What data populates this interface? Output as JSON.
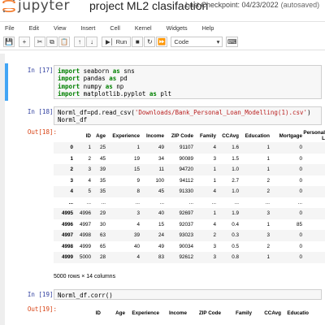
{
  "header": {
    "logo_text": "jupyter",
    "notebook_title": "project ML2 clasifaction",
    "checkpoint": "Last Checkpoint: 04/23/2022",
    "autosaved": "(autosaved)"
  },
  "menu": [
    "File",
    "Edit",
    "View",
    "Insert",
    "Cell",
    "Kernel",
    "Widgets",
    "Help"
  ],
  "toolbar": {
    "run_label": "Run",
    "cell_type": "Code"
  },
  "cells": {
    "c17": {
      "prompt": "In [17]:",
      "lines": [
        [
          "import",
          " seaborn ",
          "as",
          " sns"
        ],
        [
          "import",
          " pandas ",
          "as",
          " pd"
        ],
        [
          "import",
          " numpy ",
          "as",
          " np"
        ],
        [
          "import",
          " matplotlib.pyplot ",
          "as",
          " plt"
        ]
      ]
    },
    "c18": {
      "prompt": "In [18]:",
      "line1_pre": "Norml_df=pd.read_csv(",
      "line1_str": "'Downloads/Bank_Personal_Loan_Modelling(1).csv'",
      "line1_post": ")",
      "line2": "Norml_df",
      "out_prompt": "Out[18]:"
    },
    "c19": {
      "prompt": "In [19]:",
      "code": "Norml_df.corr()",
      "out_prompt": "Out[19]:"
    }
  },
  "table18": {
    "columns": [
      "",
      "ID",
      "Age",
      "Experience",
      "Income",
      "ZIP Code",
      "Family",
      "CCAvg",
      "Education",
      "Mortgage",
      "Personal L"
    ],
    "rows": [
      [
        "0",
        "1",
        "25",
        "1",
        "49",
        "91107",
        "4",
        "1.6",
        "1",
        "0",
        ""
      ],
      [
        "1",
        "2",
        "45",
        "19",
        "34",
        "90089",
        "3",
        "1.5",
        "1",
        "0",
        ""
      ],
      [
        "2",
        "3",
        "39",
        "15",
        "11",
        "94720",
        "1",
        "1.0",
        "1",
        "0",
        ""
      ],
      [
        "3",
        "4",
        "35",
        "9",
        "100",
        "94112",
        "1",
        "2.7",
        "2",
        "0",
        ""
      ],
      [
        "4",
        "5",
        "35",
        "8",
        "45",
        "91330",
        "4",
        "1.0",
        "2",
        "0",
        ""
      ],
      [
        "...",
        "...",
        "...",
        "...",
        "...",
        "...",
        "...",
        "...",
        "...",
        "...",
        ""
      ],
      [
        "4995",
        "4996",
        "29",
        "3",
        "40",
        "92697",
        "1",
        "1.9",
        "3",
        "0",
        ""
      ],
      [
        "4996",
        "4997",
        "30",
        "4",
        "15",
        "92037",
        "4",
        "0.4",
        "1",
        "85",
        ""
      ],
      [
        "4997",
        "4998",
        "63",
        "39",
        "24",
        "93023",
        "2",
        "0.3",
        "3",
        "0",
        ""
      ],
      [
        "4998",
        "4999",
        "65",
        "40",
        "49",
        "90034",
        "3",
        "0.5",
        "2",
        "0",
        ""
      ],
      [
        "4999",
        "5000",
        "28",
        "4",
        "83",
        "92612",
        "3",
        "0.8",
        "1",
        "0",
        ""
      ]
    ],
    "summary": "5000 rows × 14 columns"
  },
  "table19": {
    "columns": [
      "",
      "ID",
      "Age",
      "Experience",
      "Income",
      "ZIP Code",
      "Family",
      "CCAvg",
      "Educatio"
    ]
  }
}
